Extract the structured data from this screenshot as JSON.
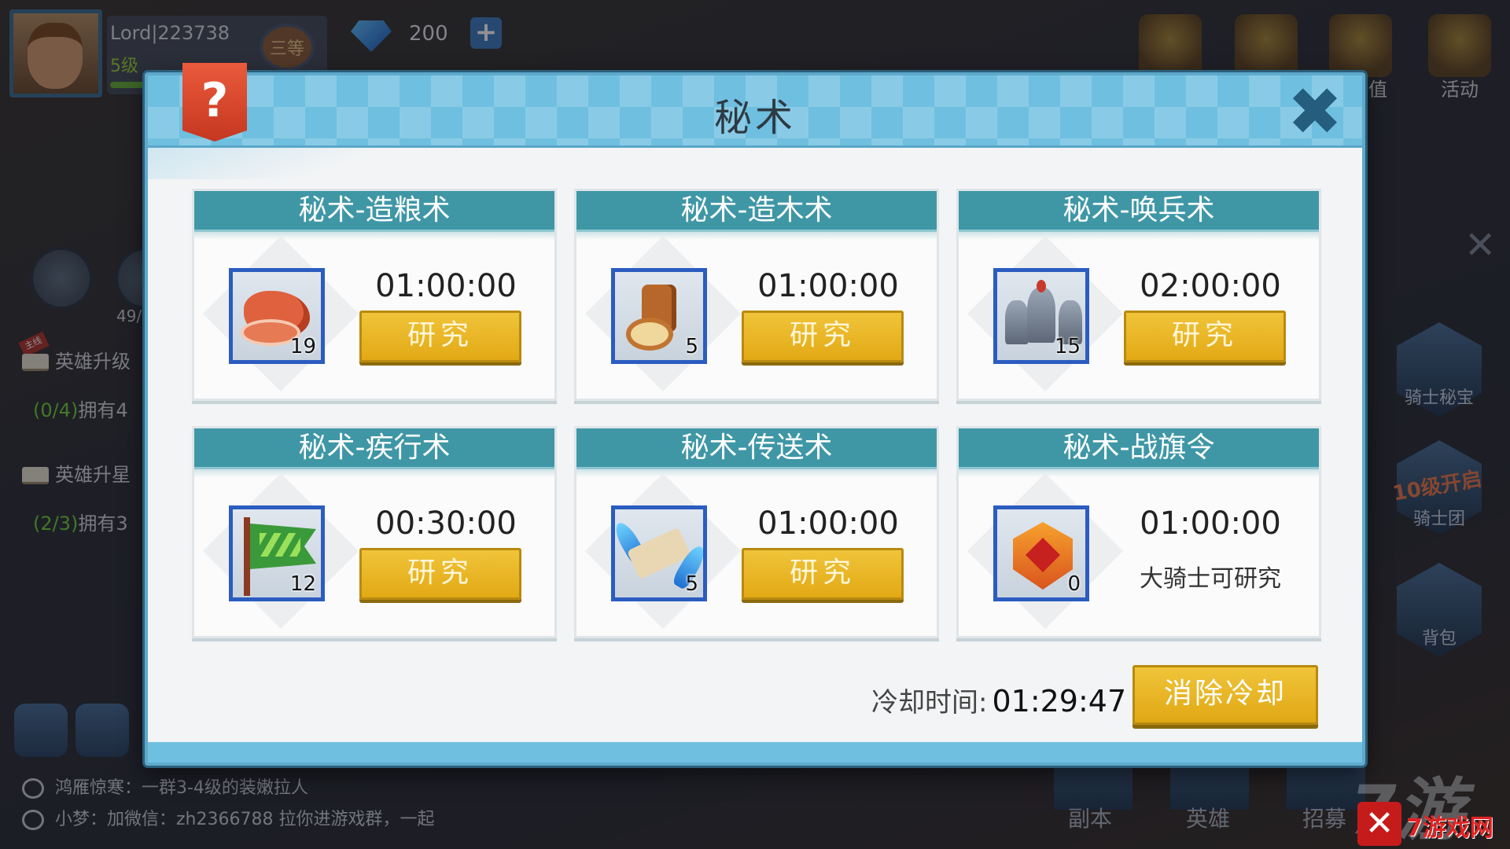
{
  "hud": {
    "player_name": "Lord|223738",
    "player_level": "5级",
    "rank_badge": "三等",
    "gems": "200",
    "top_labels": [
      "值",
      "活动"
    ],
    "left_count": "49/",
    "tasks": [
      {
        "tag": "主线",
        "title": "英雄升级",
        "progress": "(0/4)",
        "desc": "拥有4"
      },
      {
        "tag": "",
        "title": "英雄升星",
        "progress": "(2/3)",
        "desc": "拥有3"
      }
    ],
    "chat": [
      "鸿雁惊寒：一群3-4级的装嫩拉人",
      "小梦：加微信：zh2366788 拉你进游戏群，一起"
    ],
    "side_buttons": [
      {
        "label": "骑士秘宝"
      },
      {
        "label": "骑士团",
        "tag": "10级开启"
      },
      {
        "label": "背包"
      }
    ],
    "bottom_nav": [
      "副本",
      "英雄",
      "招募"
    ],
    "watermark": "7游戏网"
  },
  "modal": {
    "title": "秘术",
    "help_label": "?",
    "close_label": "✖",
    "cards": [
      {
        "title": "秘术-造粮术",
        "timer": "01:00:00",
        "count": "19",
        "icon": "meat-icon",
        "action": "研究"
      },
      {
        "title": "秘术-造木术",
        "timer": "01:00:00",
        "count": "5",
        "icon": "wood-icon",
        "action": "研究"
      },
      {
        "title": "秘术-唤兵术",
        "timer": "02:00:00",
        "count": "15",
        "icon": "knights-icon",
        "action": "研究"
      },
      {
        "title": "秘术-疾行术",
        "timer": "00:30:00",
        "count": "12",
        "icon": "flag-icon",
        "action": "研究"
      },
      {
        "title": "秘术-传送术",
        "timer": "01:00:00",
        "count": "5",
        "icon": "teleport-scroll-icon",
        "action": "研究"
      },
      {
        "title": "秘术-战旗令",
        "timer": "01:00:00",
        "count": "0",
        "icon": "war-banner-icon",
        "note": "大骑士可研究"
      }
    ],
    "cooldown_label": "冷却时间:",
    "cooldown_time": "01:29:47",
    "clear_button": "消除冷却"
  },
  "colors": {
    "header_blue": "#6fbfe0",
    "card_header": "#3f97a6",
    "button_gold": "#e8b623",
    "frame_blue": "#2b5cc0"
  }
}
